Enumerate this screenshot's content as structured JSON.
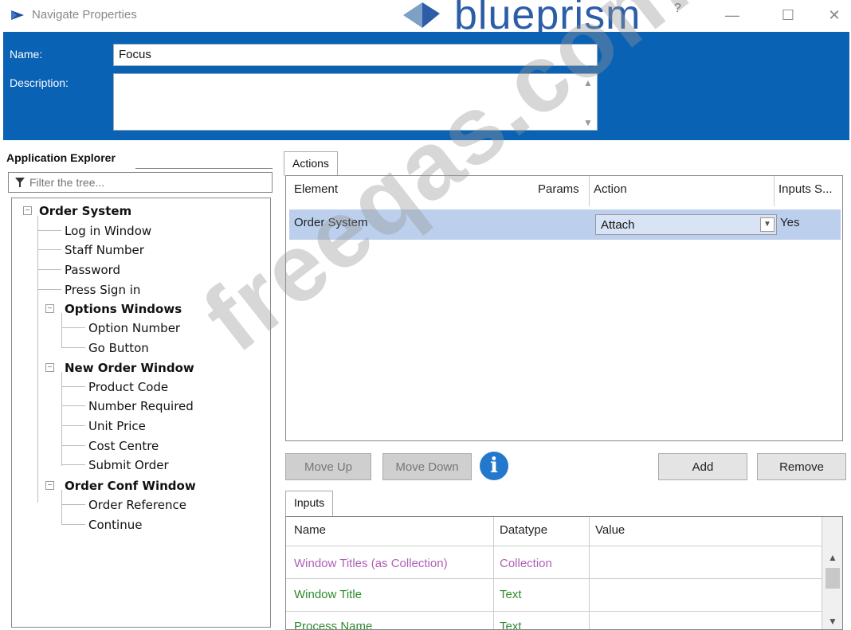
{
  "window": {
    "title": "Navigate Properties",
    "brand": "blueprism",
    "help": "?",
    "minimize": "—",
    "maximize": "☐",
    "close": "✕"
  },
  "header": {
    "name_label": "Name:",
    "name_value": "Focus",
    "description_label": "Description:",
    "description_value": ""
  },
  "explorer": {
    "title": "Application Explorer",
    "filter_placeholder": "Filter the tree...",
    "tree": {
      "root": "Order System",
      "log_in_window": "Log in Window",
      "staff_number": "Staff Number",
      "password": "Password",
      "press_sign_in": "Press Sign in",
      "options_windows": "Options Windows",
      "option_number": "Option Number",
      "go_button": "Go Button",
      "new_order_window": "New Order Window",
      "product_code": "Product Code",
      "number_required": "Number Required",
      "unit_price": "Unit Price",
      "cost_centre": "Cost Centre",
      "submit_order": "Submit Order",
      "order_conf_window": "Order Conf Window",
      "order_reference": "Order Reference",
      "continue": "Continue"
    }
  },
  "actions": {
    "tab": "Actions",
    "columns": {
      "element": "Element",
      "params": "Params",
      "action": "Action",
      "inputs_set": "Inputs S..."
    },
    "rows": [
      {
        "element": "Order System",
        "params": "",
        "action": "Attach",
        "inputs_set": "Yes"
      }
    ],
    "buttons": {
      "move_up": "Move Up",
      "move_down": "Move Down",
      "add": "Add",
      "remove": "Remove"
    }
  },
  "inputs": {
    "tab": "Inputs",
    "columns": {
      "name": "Name",
      "datatype": "Datatype",
      "value": "Value"
    },
    "rows": [
      {
        "name": "Window Titles (as Collection)",
        "datatype": "Collection",
        "value": "",
        "color": "#b060b8"
      },
      {
        "name": "Window Title",
        "datatype": "Text",
        "value": "",
        "color": "#2e8b2e"
      },
      {
        "name": "Process Name",
        "datatype": "Text",
        "value": "",
        "color": "#2e8b2e"
      }
    ]
  },
  "watermark": "freeqas.com",
  "colors": {
    "header_blue": "#0a62b5",
    "selection": "#bcd0ee",
    "collection_purple": "#b060b8",
    "text_green": "#2e8b2e",
    "info_blue": "#2378cc"
  }
}
